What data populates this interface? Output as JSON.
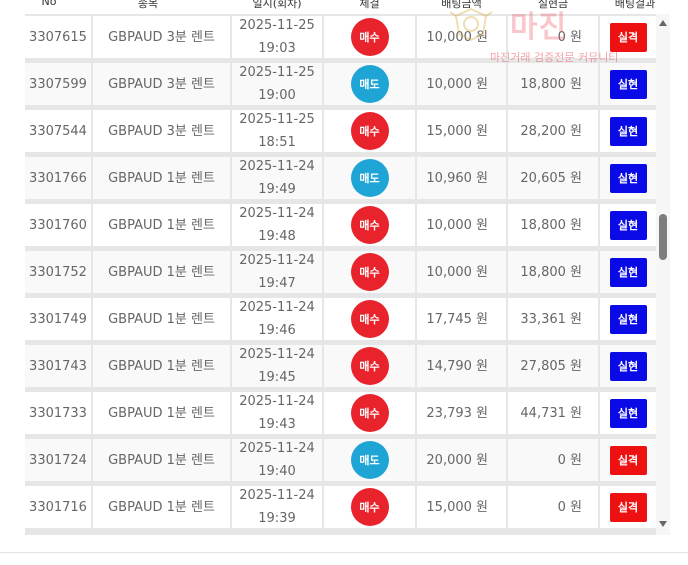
{
  "headers": {
    "no": "No",
    "item": "종목",
    "date": "일시(회차)",
    "bet_type": "체결",
    "bet_amount": "배팅금액",
    "win_amount": "실현금",
    "result": "배팅결과"
  },
  "watermark": {
    "title": "마진",
    "subtitle": "마진거래 검증전문 커뮤니티"
  },
  "colors": {
    "buy": "#e8232b",
    "sell": "#1fa4d6",
    "win": "#0a0ae6",
    "lose": "#ee1111"
  },
  "rows": [
    {
      "no": "3307615",
      "item": "GBPAUD 3분 렌트",
      "date": "2025-11-25",
      "time": "19:03",
      "bet": "매수",
      "bet_kind": "buy",
      "amount": "10,000 원",
      "win": "0 원",
      "result": "실격",
      "result_kind": "lose"
    },
    {
      "no": "3307599",
      "item": "GBPAUD 3분 렌트",
      "date": "2025-11-25",
      "time": "19:00",
      "bet": "매도",
      "bet_kind": "sell",
      "amount": "10,000 원",
      "win": "18,800 원",
      "result": "실현",
      "result_kind": "win"
    },
    {
      "no": "3307544",
      "item": "GBPAUD 3분 렌트",
      "date": "2025-11-25",
      "time": "18:51",
      "bet": "매수",
      "bet_kind": "buy",
      "amount": "15,000 원",
      "win": "28,200 원",
      "result": "실현",
      "result_kind": "win"
    },
    {
      "no": "3301766",
      "item": "GBPAUD 1분 렌트",
      "date": "2025-11-24",
      "time": "19:49",
      "bet": "매도",
      "bet_kind": "sell",
      "amount": "10,960 원",
      "win": "20,605 원",
      "result": "실현",
      "result_kind": "win"
    },
    {
      "no": "3301760",
      "item": "GBPAUD 1분 렌트",
      "date": "2025-11-24",
      "time": "19:48",
      "bet": "매수",
      "bet_kind": "buy",
      "amount": "10,000 원",
      "win": "18,800 원",
      "result": "실현",
      "result_kind": "win"
    },
    {
      "no": "3301752",
      "item": "GBPAUD 1분 렌트",
      "date": "2025-11-24",
      "time": "19:47",
      "bet": "매수",
      "bet_kind": "buy",
      "amount": "10,000 원",
      "win": "18,800 원",
      "result": "실현",
      "result_kind": "win"
    },
    {
      "no": "3301749",
      "item": "GBPAUD 1분 렌트",
      "date": "2025-11-24",
      "time": "19:46",
      "bet": "매수",
      "bet_kind": "buy",
      "amount": "17,745 원",
      "win": "33,361 원",
      "result": "실현",
      "result_kind": "win"
    },
    {
      "no": "3301743",
      "item": "GBPAUD 1분 렌트",
      "date": "2025-11-24",
      "time": "19:45",
      "bet": "매수",
      "bet_kind": "buy",
      "amount": "14,790 원",
      "win": "27,805 원",
      "result": "실현",
      "result_kind": "win"
    },
    {
      "no": "3301733",
      "item": "GBPAUD 1분 렌트",
      "date": "2025-11-24",
      "time": "19:43",
      "bet": "매수",
      "bet_kind": "buy",
      "amount": "23,793 원",
      "win": "44,731 원",
      "result": "실현",
      "result_kind": "win"
    },
    {
      "no": "3301724",
      "item": "GBPAUD 1분 렌트",
      "date": "2025-11-24",
      "time": "19:40",
      "bet": "매도",
      "bet_kind": "sell",
      "amount": "20,000 원",
      "win": "0 원",
      "result": "실격",
      "result_kind": "lose"
    },
    {
      "no": "3301716",
      "item": "GBPAUD 1분 렌트",
      "date": "2025-11-24",
      "time": "19:39",
      "bet": "매수",
      "bet_kind": "buy",
      "amount": "15,000 원",
      "win": "0 원",
      "result": "실격",
      "result_kind": "lose"
    }
  ]
}
